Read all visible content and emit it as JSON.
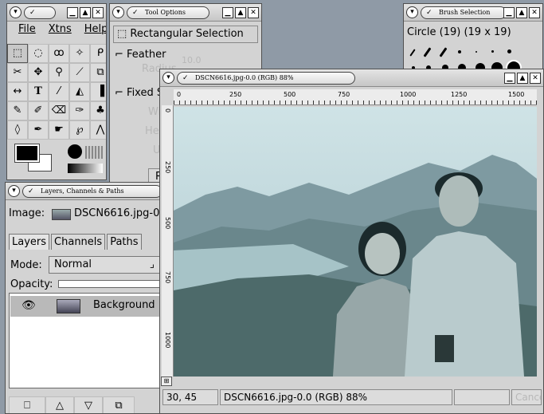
{
  "toolbox": {
    "title": "",
    "menu": [
      "File",
      "Xtns",
      "Help"
    ],
    "tools": [
      "rect-select",
      "ellipse-select",
      "free-select",
      "fuzzy-select",
      "bezier-select",
      "scissors",
      "move",
      "magnify",
      "crop",
      "transform",
      "flip",
      "text",
      "color-picker",
      "bucket-fill",
      "blend",
      "pencil",
      "paintbrush",
      "eraser",
      "airbrush",
      "clone",
      "convolve",
      "ink",
      "smudge",
      "dodge-burn",
      "measure"
    ]
  },
  "tool_options": {
    "title": "Tool Options",
    "heading": "Rectangular Selection",
    "feather_label": "Feather",
    "radius_label": "Radius",
    "radius_value": "10.0",
    "fixed_label": "Fixed S",
    "width_label": "Wid",
    "height_label": "Heig",
    "unit_label": "Un",
    "reset_label": "R"
  },
  "brush_selection": {
    "title": "Brush Selection",
    "brush_name": "Circle (19)  (19 x 19)"
  },
  "layers": {
    "title": "Layers, Channels & Paths",
    "image_label": "Image:",
    "image_name": "DSCN6616.jpg-0",
    "tabs": [
      "Layers",
      "Channels",
      "Paths"
    ],
    "mode_label": "Mode:",
    "mode_value": "Normal",
    "opacity_label": "Opacity:",
    "layer_name": "Background"
  },
  "image_window": {
    "title": "DSCN6616.jpg-0.0 (RGB) 88%",
    "ruler_labels": [
      "0",
      "250",
      "500",
      "750",
      "1000",
      "1250",
      "1500"
    ],
    "vruler_labels": [
      "0",
      "250",
      "500",
      "750",
      "1000"
    ],
    "status_coords": "30, 45",
    "status_text": "DSCN6616.jpg-0.0 (RGB) 88%",
    "cancel_label": "Cancel"
  }
}
